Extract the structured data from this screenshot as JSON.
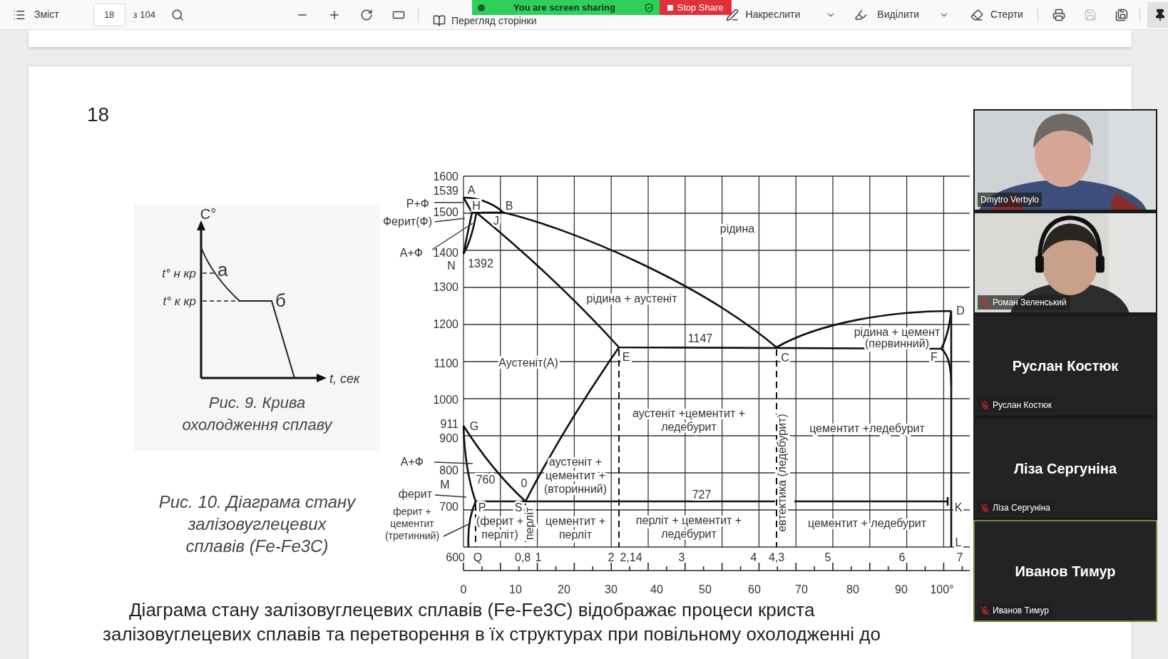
{
  "toolbar": {
    "contents_label": "Зміст",
    "page": "18",
    "page_total": "з 104",
    "view_label": "Перегляд сторінки",
    "draw_label": "Накреслити",
    "highlight_label": "Виділити",
    "erase_label": "Стерти",
    "save_disabled": true,
    "pinned": true
  },
  "share_banner": {
    "status": "You are screen sharing",
    "stop_label": "Stop Share"
  },
  "page": {
    "number": "18",
    "figure_9": {
      "y_axis": "C°",
      "x_axis": "t, сек",
      "level_labels": [
        "t° н кр",
        "t° к кр"
      ],
      "point_labels": [
        "а",
        "б"
      ],
      "caption_lines": [
        "Рис. 9. Крива",
        "охолодження сплаву"
      ]
    },
    "figure_10": {
      "caption_lines": [
        "Рис. 10. Діаграма стану",
        "залізовуглецевих",
        "сплавів (Fe-Fe3C)"
      ]
    },
    "diagram": {
      "temperature_ticks": [
        "1600",
        "1539",
        "1500",
        "1400",
        "1300",
        "1200",
        "1100",
        "1000",
        "911",
        "900",
        "800",
        "700",
        "600"
      ],
      "point_labels": [
        "A",
        "H",
        "B",
        "J",
        "N",
        "1392",
        "E",
        "G",
        "M",
        "760",
        "0",
        "P",
        "S",
        "Q",
        "C",
        "D",
        "F",
        "K",
        "L",
        "1147",
        "727"
      ],
      "side_labels": [
        {
          "lines": [
            "Р+Ф"
          ]
        },
        {
          "lines": [
            "Ферит(Ф)"
          ]
        },
        {
          "lines": [
            "А+Ф"
          ]
        },
        {
          "lines": [
            "А+Ф"
          ]
        },
        {
          "lines": [
            "ферит"
          ]
        },
        {
          "lines": [
            "ферит +",
            "цементит",
            "(третинний)"
          ]
        }
      ],
      "region_labels": [
        {
          "lines": [
            "рідина"
          ]
        },
        {
          "lines": [
            "рідина + аустеніт"
          ]
        },
        {
          "lines": [
            "Аустеніт(А)"
          ]
        },
        {
          "lines": [
            "рідина + цемент",
            "(первинний)"
          ]
        },
        {
          "lines": [
            "аустеніт +цементит +",
            "ледебурит"
          ]
        },
        {
          "lines": [
            "цементит +ледебурит"
          ]
        },
        {
          "lines": [
            "аустеніт +",
            "цементит +",
            "(вторинний)"
          ]
        },
        {
          "lines": [
            "(ферит +",
            "перліт)"
          ]
        },
        {
          "lines": [
            "перліт"
          ]
        },
        {
          "lines": [
            "цементит +",
            "перліт"
          ]
        },
        {
          "lines": [
            "перліт + цементит +",
            "ледебурит"
          ]
        },
        {
          "lines": [
            "евтектика (ледебурит)"
          ]
        },
        {
          "lines": [
            "цементит + ледебурит"
          ]
        }
      ],
      "carbon_ticks": [
        "0,8",
        "1",
        "2",
        "2,14",
        "3",
        "4",
        "4,3",
        "5",
        "6",
        "7"
      ],
      "percent_ticks": [
        "0",
        "10",
        "20",
        "30",
        "40",
        "50",
        "60",
        "70",
        "80",
        "90",
        "100°"
      ]
    },
    "paragraph_lines": [
      "Діаграма стану залізовуглецевих сплавів (Fe-Fe3C) відображає процеси криста",
      "залізовуглецевих сплавів та перетворення в їх структурах при повільному охолодженні до"
    ]
  },
  "participants": [
    {
      "kind": "video",
      "name": "Dmytro Verbylo",
      "muted": false,
      "speaking": false
    },
    {
      "kind": "video",
      "name": "Роман Зеленський",
      "muted": true,
      "speaking": false
    },
    {
      "kind": "avatar",
      "display_name": "Руслан Костюк",
      "name": "Руслан Костюк",
      "muted": true,
      "speaking": false
    },
    {
      "kind": "avatar",
      "display_name": "Ліза Сергуніна",
      "name": "Ліза Сергуніна",
      "muted": true,
      "speaking": false
    },
    {
      "kind": "avatar",
      "display_name": "Иванов Тимур",
      "name": "Иванов Тимур",
      "muted": true,
      "speaking": true
    }
  ]
}
